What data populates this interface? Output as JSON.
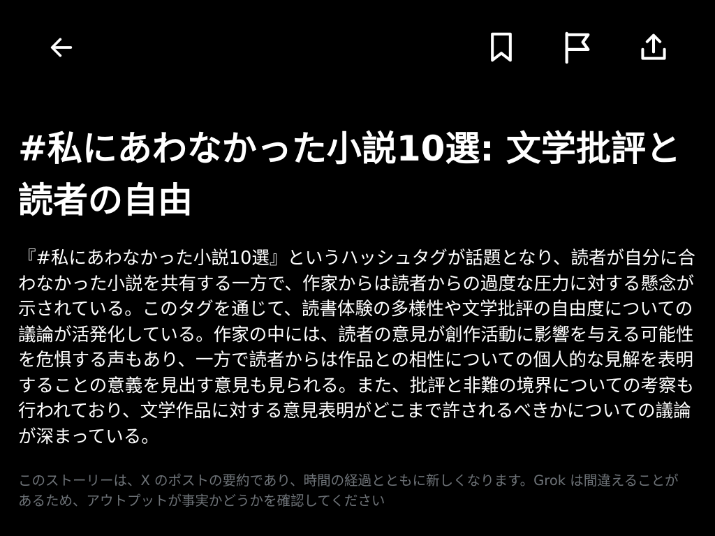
{
  "header": {
    "back_icon": "arrow-left-icon",
    "bookmark_icon": "bookmark-icon",
    "flag_icon": "flag-icon",
    "share_icon": "share-upload-icon"
  },
  "story": {
    "title": "#私にあわなかった小説10選: 文学批評と読者の自由",
    "summary": "『#私にあわなかった小説10選』というハッシュタグが話題となり、読者が自分に合わなかった小説を共有する一方で、作家からは読者からの過度な圧力に対する懸念が示されている。このタグを通じて、読書体験の多様性や文学批評の自由度についての議論が活発化している。作家の中には、読者の意見が創作活動に影響を与える可能性を危惧する声もあり、一方で読者からは作品との相性についての個人的な見解を表明することの意義を見出す意見も見られる。また、批評と非難の境界についての考察も行われており、文学作品に対する意見表明がどこまで許されるべきかについての議論が深まっている。",
    "disclaimer": "このストーリーは、X のポストの要約であり、時間の経過とともに新しくなります。Grok は間違えることがあるため、アウトプットが事実かどうかを確認してください"
  },
  "colors": {
    "background": "#000000",
    "text": "#ffffff",
    "muted": "#6e7378"
  }
}
